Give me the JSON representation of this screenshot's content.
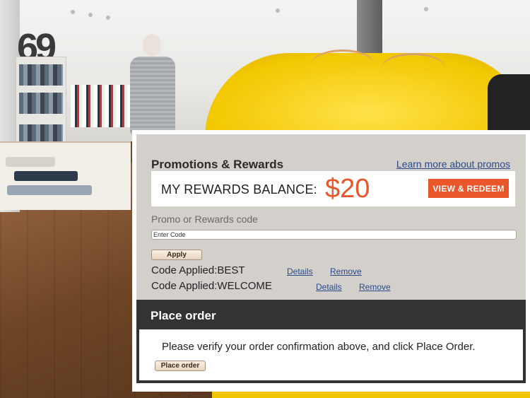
{
  "background": {
    "store_number": "69"
  },
  "promotions": {
    "title": "Promotions & Rewards",
    "learn_more_link": "Learn more about promos",
    "rewards_label": "MY REWARDS BALANCE:",
    "rewards_amount": "$20",
    "redeem_button": "VIEW & REDEEM",
    "code_label": "Promo or Rewards code",
    "code_placeholder": "Enter Code",
    "apply_button": "Apply",
    "applied_codes": [
      {
        "text": "Code Applied:BEST",
        "details": "Details",
        "remove": "Remove"
      },
      {
        "text": "Code Applied:WELCOME",
        "details": "Details",
        "remove": "Remove"
      }
    ]
  },
  "place_order": {
    "title": "Place order",
    "instruction": "Please verify your order confirmation above, and click Place Order.",
    "button": "Place order"
  },
  "colors": {
    "accent": "#e8562a",
    "panel_gray": "#d3d0cc",
    "header_dark": "#333333",
    "link_blue": "#2a4a8a"
  }
}
